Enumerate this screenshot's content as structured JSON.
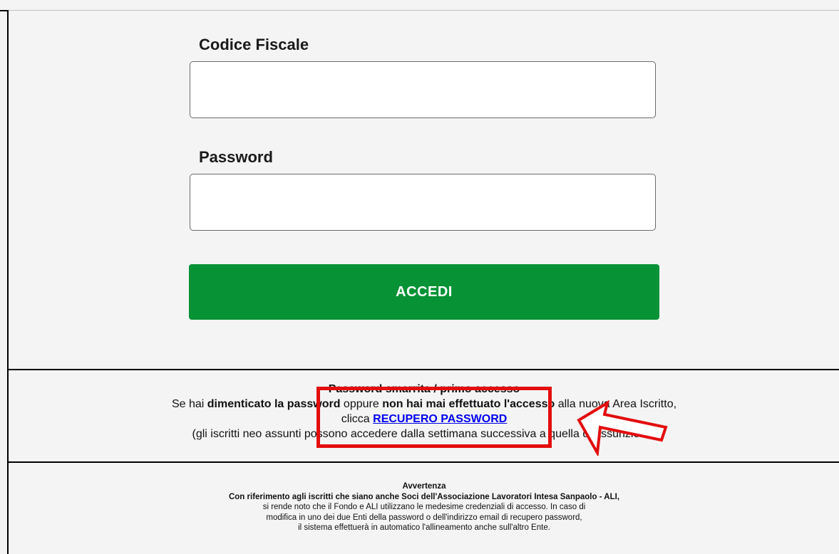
{
  "form": {
    "codice_fiscale_label": "Codice Fiscale",
    "codice_fiscale_value": "",
    "password_label": "Password",
    "password_value": "",
    "login_button": "ACCEDI"
  },
  "lost_password": {
    "title": "Password smarrita / primo accesso",
    "line1_a": "Se hai ",
    "line1_b": "dimenticato la password",
    "line1_c": " oppure ",
    "line1_d": "non hai mai effettuato l'accesso",
    "line1_e": " alla nuova Area Iscritto,",
    "line2_prefix": "clicca ",
    "link_label": "RECUPERO PASSWORD",
    "note": "(gli iscritti neo assunti possono accedere dalla settimana successiva a quella di assunzione)"
  },
  "warning": {
    "title": "Avvertenza",
    "line1": "Con riferimento agli iscritti che siano anche Soci dell'Associazione Lavoratori Intesa Sanpaolo - ALI,",
    "line2": "si rende noto che il Fondo e ALI utilizzano le medesime credenziali di accesso. In caso di",
    "line3": "modifica in uno dei due Enti della password o dell'indirizzo email di recupero password,",
    "line4": "il sistema effettuerà in automatico l'allineamento anche sull'altro Ente."
  },
  "annotation": {
    "highlight_color": "#e30d0d",
    "arrow_icon": "arrow-pointing-up-left"
  },
  "colors": {
    "login_button": "#079235",
    "link": "#0000ee"
  }
}
